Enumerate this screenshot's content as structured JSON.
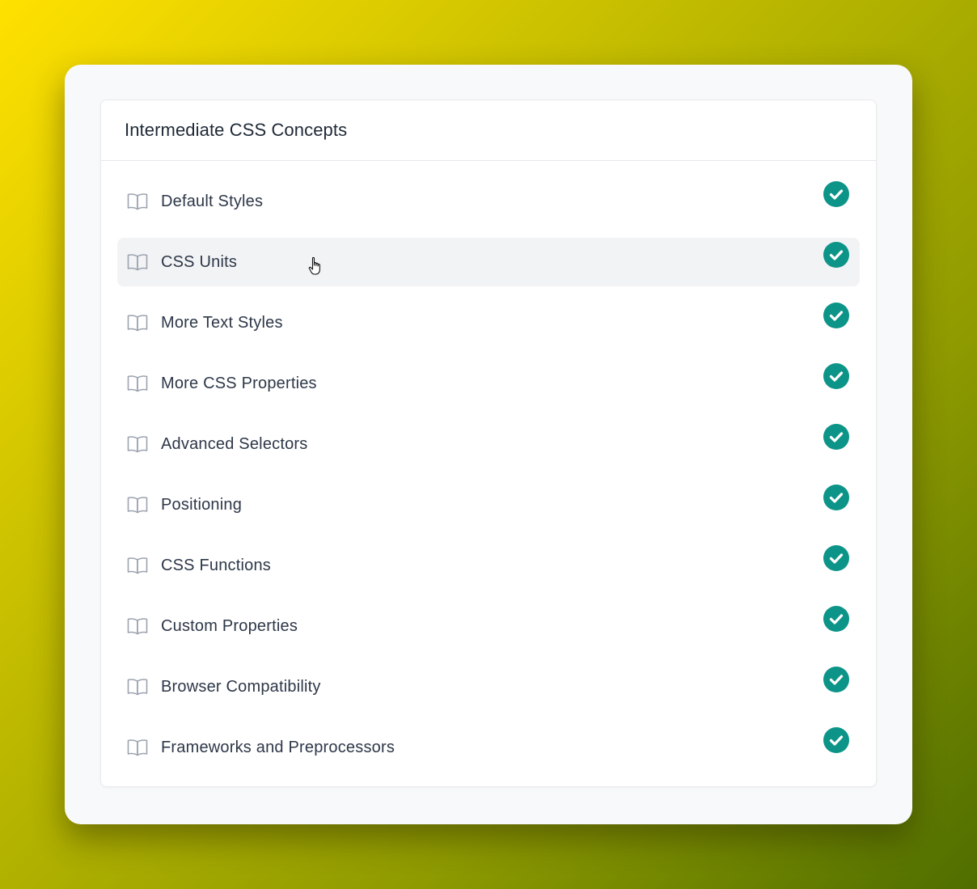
{
  "card": {
    "title": "Intermediate CSS Concepts"
  },
  "lessons": [
    {
      "label": "Default Styles",
      "completed": true
    },
    {
      "label": "CSS Units",
      "completed": true,
      "hovered": true
    },
    {
      "label": "More Text Styles",
      "completed": true
    },
    {
      "label": "More CSS Properties",
      "completed": true
    },
    {
      "label": "Advanced Selectors",
      "completed": true
    },
    {
      "label": "Positioning",
      "completed": true
    },
    {
      "label": "CSS Functions",
      "completed": true
    },
    {
      "label": "Custom Properties",
      "completed": true
    },
    {
      "label": "Browser Compatibility",
      "completed": true
    },
    {
      "label": "Frameworks and Preprocessors",
      "completed": true
    }
  ],
  "icons": {
    "lesson": "book-open-icon",
    "status": "check-circle-icon",
    "pointer": "hand-pointer-icon"
  },
  "colors": {
    "accent": "#0d9488",
    "text": "#2d3748",
    "icon": "#9ca3af",
    "hover_bg": "#f2f3f5"
  }
}
